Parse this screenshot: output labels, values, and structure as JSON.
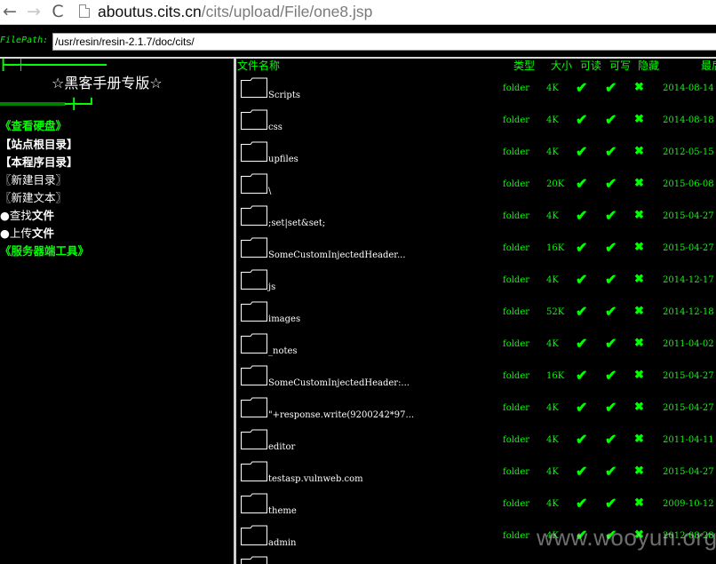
{
  "browser": {
    "url_host": "aboutus.cits.cn",
    "url_path": "/cits/upload/File/one8.jsp",
    "back_icon": "back-arrow-icon",
    "forward_icon": "forward-arrow-icon",
    "reload_icon": "reload-icon",
    "back_glyph": "←",
    "forward_glyph": "→",
    "reload_glyph": "C"
  },
  "filepath": {
    "label": "FilePath:",
    "value": "/usr/resin/resin-2.1.7/doc/cits/"
  },
  "sidebar": {
    "deco_top": "┣━━┿━━━━━━━━━━━━━━",
    "title": "☆黑客手册专版☆",
    "deco_bottom": "═══════════━╋━━┛",
    "items": [
      {
        "label": "《查看硬盘》"
      },
      {
        "label": "【站点根目录】"
      },
      {
        "label": "【本程序目录】"
      },
      {
        "label": "〖新建目录〗"
      },
      {
        "label": "〖新建文本〗"
      },
      {
        "bullet": "●",
        "prefix": "查找",
        "suffix": "文件"
      },
      {
        "bullet": "●",
        "prefix": "上传",
        "suffix": "文件"
      },
      {
        "label": "《服务器端工具》"
      }
    ]
  },
  "table": {
    "headers": {
      "name": "文件名称",
      "type": "类型",
      "size": "大小",
      "read": "可读",
      "write": "可写",
      "hidden": "隐藏",
      "date": "最后"
    },
    "check_glyph": "✔",
    "cross_glyph": "✖",
    "rows": [
      {
        "name": "Scripts",
        "type": "folder",
        "size": "4K",
        "date": "2014-08-14"
      },
      {
        "name": "css",
        "type": "folder",
        "size": "4K",
        "date": "2014-08-18"
      },
      {
        "name": "upfiles",
        "type": "folder",
        "size": "4K",
        "date": "2012-05-15"
      },
      {
        "name": "\\",
        "type": "folder",
        "size": "20K",
        "date": "2015-06-08"
      },
      {
        "name": ";set|set&set;",
        "type": "folder",
        "size": "4K",
        "date": "2015-04-27"
      },
      {
        "name": " SomeCustomInjectedHeader...",
        "type": "folder",
        "size": "16K",
        "date": "2015-04-27"
      },
      {
        "name": "js",
        "type": "folder",
        "size": "4K",
        "date": "2014-12-17"
      },
      {
        "name": "images",
        "type": "folder",
        "size": "52K",
        "date": "2014-12-18"
      },
      {
        "name": "_notes",
        "type": "folder",
        "size": "4K",
        "date": "2011-04-02"
      },
      {
        "name": " SomeCustomInjectedHeader:...",
        "type": "folder",
        "size": "16K",
        "date": "2015-04-27"
      },
      {
        "name": "\"+response.write(9200242*97...",
        "type": "folder",
        "size": "4K",
        "date": "2015-04-27"
      },
      {
        "name": "editor",
        "type": "folder",
        "size": "4K",
        "date": "2011-04-11"
      },
      {
        "name": "testasp.vulnweb.com",
        "type": "folder",
        "size": "4K",
        "date": "2015-04-27"
      },
      {
        "name": "theme",
        "type": "folder",
        "size": "4K",
        "date": "2009-10-12"
      },
      {
        "name": "admin",
        "type": "folder",
        "size": "4K",
        "date": "2012-08-28"
      }
    ]
  },
  "watermark": "www.wooyun.org",
  "colors": {
    "accent_green": "#00ff00",
    "background": "#000000"
  }
}
